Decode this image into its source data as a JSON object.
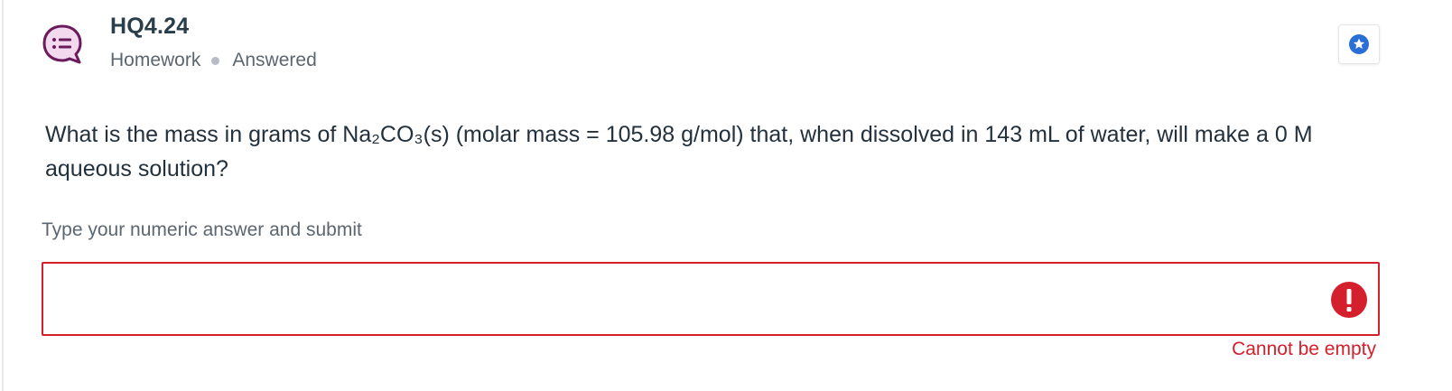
{
  "header": {
    "title": "HQ4.24",
    "category": "Homework",
    "status": "Answered",
    "icon": "question-bubble-icon",
    "accent_color": "#6b1a5e"
  },
  "bookmark": {
    "icon": "star-icon",
    "color": "#2a6fd6"
  },
  "question": {
    "text": "What is the mass in grams of Na₂CO₃(s) (molar mass = 105.98 g/mol) that, when dissolved in 143 mL of water, will make a 0 M aqueous solution?"
  },
  "answer": {
    "label": "Type your numeric answer and submit",
    "value": "",
    "error_icon": "exclamation-icon",
    "error_message": "Cannot be empty",
    "error_color": "#d4202c"
  }
}
